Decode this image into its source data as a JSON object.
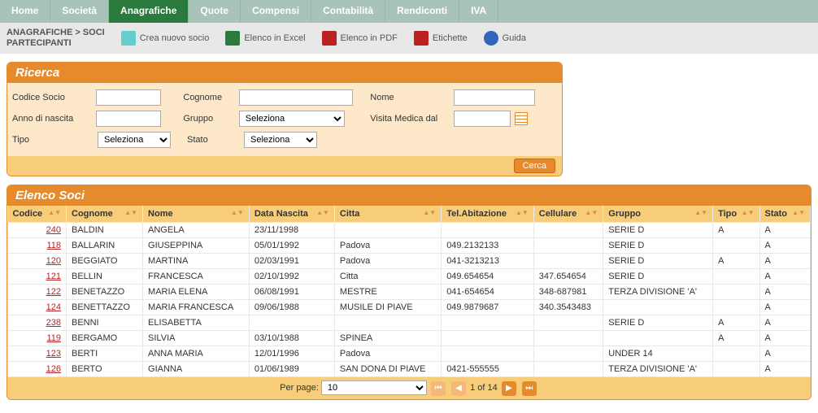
{
  "nav": {
    "tabs": [
      "Home",
      "Società",
      "Anagrafiche",
      "Quote",
      "Compensi",
      "Contabilità",
      "Rendiconti",
      "IVA"
    ],
    "active_index": 2
  },
  "breadcrumb": {
    "line1": "ANAGRAFICHE > SOCI",
    "line2": "PARTECIPANTI"
  },
  "actions": {
    "new": "Crea nuovo socio",
    "excel": "Elenco in Excel",
    "pdf": "Elenco in PDF",
    "labels": "Etichette",
    "help": "Guida"
  },
  "search": {
    "title": "Ricerca",
    "labels": {
      "codice": "Codice Socio",
      "cognome": "Cognome",
      "nome": "Nome",
      "anno": "Anno di nascita",
      "gruppo": "Gruppo",
      "visita": "Visita Medica dal",
      "tipo": "Tipo",
      "stato": "Stato"
    },
    "placeholders": {
      "select": "Seleziona"
    },
    "button": "Cerca"
  },
  "list": {
    "title": "Elenco Soci",
    "columns": [
      "Codice",
      "Cognome",
      "Nome",
      "Data Nascita",
      "Citta",
      "Tel.Abitazione",
      "Cellulare",
      "Gruppo",
      "Tipo",
      "Stato"
    ],
    "rows": [
      {
        "codice": "240",
        "cognome": "BALDIN",
        "nome": "ANGELA",
        "data": "23/11/1998",
        "citta": "",
        "tel": "",
        "cell": "",
        "gruppo": "SERIE D",
        "tipo": "A",
        "stato": "A"
      },
      {
        "codice": "118",
        "cognome": "BALLARIN",
        "nome": "GIUSEPPINA",
        "data": "05/01/1992",
        "citta": "Padova",
        "tel": "049.2132133",
        "cell": "",
        "gruppo": "SERIE D",
        "tipo": "",
        "stato": "A"
      },
      {
        "codice": "120",
        "cognome": "BEGGIATO",
        "nome": "MARTINA",
        "data": "02/03/1991",
        "citta": "Padova",
        "tel": "041-3213213",
        "cell": "",
        "gruppo": "SERIE D",
        "tipo": "A",
        "stato": "A"
      },
      {
        "codice": "121",
        "cognome": "BELLIN",
        "nome": "FRANCESCA",
        "data": "02/10/1992",
        "citta": "Citta",
        "tel": "049.654654",
        "cell": "347.654654",
        "gruppo": "SERIE D",
        "tipo": "",
        "stato": "A"
      },
      {
        "codice": "122",
        "cognome": "BENETAZZO",
        "nome": "MARIA ELENA",
        "data": "06/08/1991",
        "citta": "MESTRE",
        "tel": "041-654654",
        "cell": "348-687981",
        "gruppo": "TERZA DIVISIONE 'A'",
        "tipo": "",
        "stato": "A"
      },
      {
        "codice": "124",
        "cognome": "BENETTAZZO",
        "nome": "MARIA FRANCESCA",
        "data": "09/06/1988",
        "citta": "MUSILE DI PIAVE",
        "tel": "049.9879687",
        "cell": "340.3543483",
        "gruppo": "",
        "tipo": "",
        "stato": "A"
      },
      {
        "codice": "238",
        "cognome": "BENNI",
        "nome": "ELISABETTA",
        "data": "",
        "citta": "",
        "tel": "",
        "cell": "",
        "gruppo": "SERIE D",
        "tipo": "A",
        "stato": "A"
      },
      {
        "codice": "119",
        "cognome": "BERGAMO",
        "nome": "SILVIA",
        "data": "03/10/1988",
        "citta": "SPINEA",
        "tel": "",
        "cell": "",
        "gruppo": "",
        "tipo": "A",
        "stato": "A"
      },
      {
        "codice": "123",
        "cognome": "BERTI",
        "nome": "ANNA MARIA",
        "data": "12/01/1996",
        "citta": "Padova",
        "tel": "",
        "cell": "",
        "gruppo": "UNDER 14",
        "tipo": "",
        "stato": "A"
      },
      {
        "codice": "126",
        "cognome": "BERTO",
        "nome": "GIANNA",
        "data": "01/06/1989",
        "citta": "SAN DONA DI PIAVE",
        "tel": "0421-555555",
        "cell": "",
        "gruppo": "TERZA DIVISIONE 'A'",
        "tipo": "",
        "stato": "A"
      }
    ],
    "pager": {
      "per_page_label": "Per page:",
      "per_page_value": "10",
      "position": "1 of 14"
    }
  }
}
